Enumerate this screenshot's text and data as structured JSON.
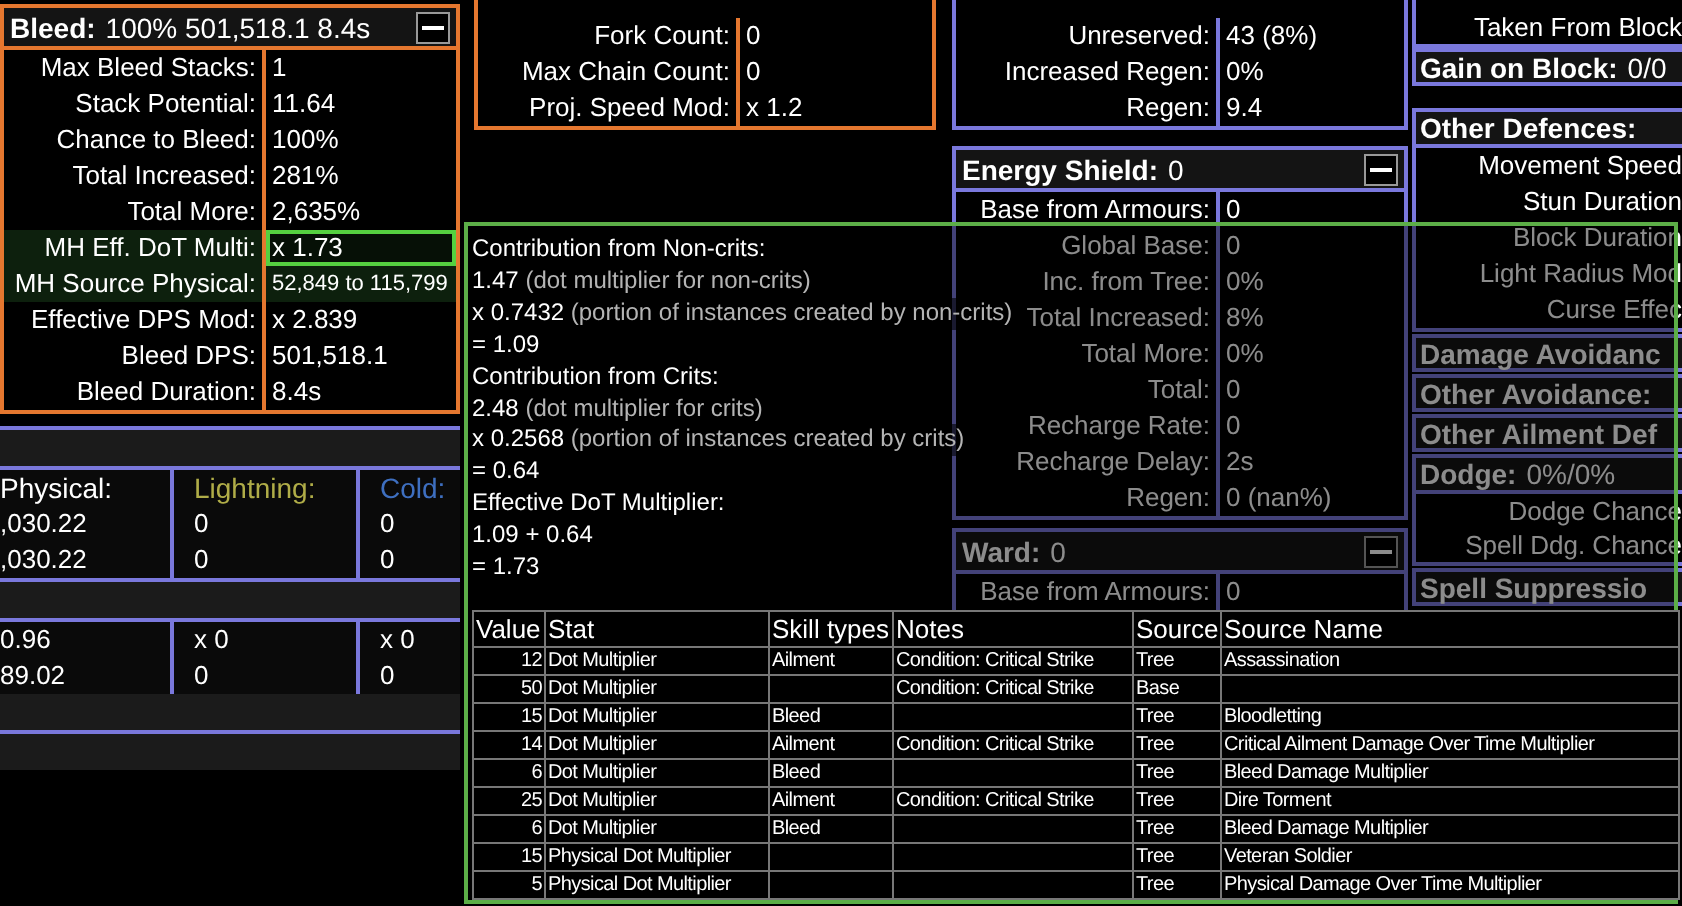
{
  "bleed_panel": {
    "title": "Bleed:",
    "summary": "100% 501,518.1 8.4s",
    "rows": [
      {
        "label": "Max Bleed Stacks:",
        "value": "1",
        "highlighted": false,
        "selected": false,
        "compact": false
      },
      {
        "label": "Stack Potential:",
        "value": "11.64",
        "highlighted": false,
        "selected": false,
        "compact": false
      },
      {
        "label": "Chance to Bleed:",
        "value": "100%",
        "highlighted": false,
        "selected": false,
        "compact": false
      },
      {
        "label": "Total Increased:",
        "value": "281%",
        "highlighted": false,
        "selected": false,
        "compact": false
      },
      {
        "label": "Total More:",
        "value": "2,635%",
        "highlighted": false,
        "selected": false,
        "compact": false
      },
      {
        "label": "MH Eff. DoT Multi:",
        "value": "x 1.73",
        "highlighted": true,
        "selected": true,
        "compact": false
      },
      {
        "label": "MH Source Physical:",
        "value": "52,849 to 115,799",
        "highlighted": true,
        "selected": false,
        "compact": true
      },
      {
        "label": "Effective DPS Mod:",
        "value": "x 2.839",
        "highlighted": false,
        "selected": false,
        "compact": false
      },
      {
        "label": "Bleed DPS:",
        "value": "501,518.1",
        "highlighted": false,
        "selected": false,
        "compact": false
      },
      {
        "label": "Bleed Duration:",
        "value": "8.4s",
        "highlighted": false,
        "selected": false,
        "compact": false
      }
    ]
  },
  "damage_table": {
    "columns": [
      {
        "label": "Physical:",
        "color": "#ffffff"
      },
      {
        "label": "Lightning:",
        "color": "#b0ad48"
      },
      {
        "label": "Cold:",
        "color": "#3e6fc0"
      }
    ],
    "groups": [
      [
        [
          ",030.22",
          "0",
          "0"
        ],
        [
          ",030.22",
          "0",
          "0"
        ]
      ],
      [
        [
          "0.96",
          "x 0",
          "x 0"
        ],
        [
          "89.02",
          "0",
          "0"
        ]
      ]
    ]
  },
  "projectile_panel": {
    "rows": [
      {
        "label": "Fork Count:",
        "value": "0"
      },
      {
        "label": "Max Chain Count:",
        "value": "0"
      },
      {
        "label": "Proj. Speed Mod:",
        "value": "x 1.2"
      }
    ]
  },
  "mana_panel": {
    "rows": [
      {
        "label": "Unreserved:",
        "value": "43 (8%)"
      },
      {
        "label": "Increased Regen:",
        "value": "0%"
      },
      {
        "label": "Regen:",
        "value": "9.4"
      }
    ]
  },
  "energy_shield_panel": {
    "title": "Energy Shield:",
    "summary": "0",
    "rows": [
      {
        "label": "Base from Armours:",
        "value": "0"
      },
      {
        "label": "Global Base:",
        "value": "0"
      },
      {
        "label": "Inc. from Tree:",
        "value": "0%"
      },
      {
        "label": "Total Increased:",
        "value": "8%"
      },
      {
        "label": "Total More:",
        "value": "0%"
      },
      {
        "label": "Total:",
        "value": "0"
      },
      {
        "label": "Recharge Rate:",
        "value": "0"
      },
      {
        "label": "Recharge Delay:",
        "value": "2s"
      },
      {
        "label": "Regen:",
        "value": "0 (nan%)"
      }
    ]
  },
  "ward_panel": {
    "title": "Ward:",
    "summary": "0",
    "rows": [
      {
        "label": "Base from Armours:",
        "value": "0"
      }
    ]
  },
  "defence_column": [
    {
      "rows": [
        "Taken From Block"
      ]
    },
    {
      "title": "Gain on Block:",
      "summary": "0/0"
    },
    {
      "title": "Other Defences:",
      "rows": [
        "Movement Speed",
        "Stun Duration",
        "Block Duration",
        "Light Radius Mod",
        "Curse Effec"
      ]
    },
    {
      "title": "Damage Avoidanc"
    },
    {
      "title": "Other Avoidance:"
    },
    {
      "title": "Other Ailment Def"
    },
    {
      "title": "Dodge:",
      "summary": "0%/0%",
      "rows": [
        "Dodge Chance",
        "Spell Ddg. Chance"
      ]
    },
    {
      "title": "Spell Suppressio"
    }
  ],
  "tooltip": {
    "lines": [
      {
        "text": "Contribution from Non-crits:"
      },
      {
        "text": "1.47",
        "note": "(dot multiplier for non-crits)"
      },
      {
        "text": "x 0.7432",
        "note": "(portion of instances created by non-crits)"
      },
      {
        "text": "= 1.09"
      },
      {
        "text": "Contribution from Crits:"
      },
      {
        "text": "2.48",
        "note": "(dot multiplier for crits)"
      },
      {
        "text": "x 0.2568",
        "note": "(portion of instances created by crits)"
      },
      {
        "text": "= 0.64"
      },
      {
        "text": "Effective DoT Multiplier:"
      },
      {
        "text": "1.09 + 0.64"
      },
      {
        "text": "= 1.73"
      }
    ],
    "table": {
      "columns": [
        "Value",
        "Stat",
        "Skill types",
        "Notes",
        "Source",
        "Source Name"
      ],
      "rows": [
        [
          "12",
          "Dot Multiplier",
          "Ailment",
          "Condition: Critical Strike",
          "Tree",
          "Assassination"
        ],
        [
          "50",
          "Dot Multiplier",
          "",
          "Condition: Critical Strike",
          "Base",
          ""
        ],
        [
          "15",
          "Dot Multiplier",
          "Bleed",
          "",
          "Tree",
          "Bloodletting"
        ],
        [
          "14",
          "Dot Multiplier",
          "Ailment",
          "Condition: Critical Strike",
          "Tree",
          "Critical Ailment Damage Over Time Multiplier"
        ],
        [
          "6",
          "Dot Multiplier",
          "Bleed",
          "",
          "Tree",
          "Bleed Damage Multiplier"
        ],
        [
          "25",
          "Dot Multiplier",
          "Ailment",
          "Condition: Critical Strike",
          "Tree",
          "Dire Torment"
        ],
        [
          "6",
          "Dot Multiplier",
          "Bleed",
          "",
          "Tree",
          "Bleed Damage Multiplier"
        ],
        [
          "15",
          "Physical Dot Multiplier",
          "",
          "",
          "Tree",
          "Veteran Soldier"
        ],
        [
          "5",
          "Physical Dot Multiplier",
          "",
          "",
          "Tree",
          "Physical Damage Over Time Multiplier"
        ]
      ]
    }
  }
}
